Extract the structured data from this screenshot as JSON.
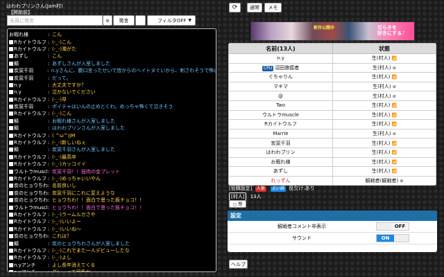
{
  "room": {
    "title": "はわわプリンさん(Jam村)",
    "phase": "【開始前】"
  },
  "composer": {
    "placeholder": "全員に発言",
    "say_label": "発言",
    "menu_icon": "≡",
    "color_icon": "■",
    "filter_label": "フィルタOFF",
    "filter_caret": "▼"
  },
  "log": [
    {
      "speaker": "お暇れ様",
      "checkbox": false,
      "text": "こん",
      "color": "#ffd54a"
    },
    {
      "speaker": "Rカイトウルフ",
      "checkbox": true,
      "text": "(-_-)こん",
      "color": "#ffd54a"
    },
    {
      "speaker": "Rカイトウルフ",
      "checkbox": true,
      "text": "(-_-)濁がた",
      "color": "#ffd54a"
    },
    {
      "speaker": "あずし",
      "checkbox": true,
      "text": "こん",
      "color": "#ffd54a"
    },
    {
      "speaker": "鯖",
      "checkbox": true,
      "text": "あずしさんが入室しました",
      "color": "#6fc6ff"
    },
    {
      "speaker": "炭窯千羽",
      "checkbox": true,
      "text": "n.yさんに、腹口言ったせいで皆からのヘイトヌぐいから、刺されそうで怖い",
      "color": "#6fc6ff"
    },
    {
      "speaker": "炭窯千羽",
      "checkbox": true,
      "text": "だって。",
      "color": "#6fc6ff"
    },
    {
      "speaker": "n.y",
      "checkbox": true,
      "text": "大丈夫ですか？",
      "color": "#ffd54a"
    },
    {
      "speaker": "n.y",
      "checkbox": true,
      "text": "泣かないでください",
      "color": "#ffd54a"
    },
    {
      "speaker": "Rカイトウルフ",
      "checkbox": true,
      "text": "(-_-)早",
      "color": "#ffd54a"
    },
    {
      "speaker": "炭窯千羽",
      "checkbox": true,
      "text": "ポイテャはいんの止めとくわ。めっちゃ怖くて泣きそう",
      "color": "#6fc6ff"
    },
    {
      "speaker": "Rカイトウルフ",
      "checkbox": true,
      "text": "(-_-)こん",
      "color": "#ffd54a"
    },
    {
      "speaker": "鯖",
      "checkbox": true,
      "text": "お暇れ様さんが入室しました",
      "color": "#6fc6ff"
    },
    {
      "speaker": "鯖",
      "checkbox": true,
      "text": "はわわプリンさんが入室しました",
      "color": "#6fc6ff"
    },
    {
      "speaker": "Rカイトウルフ",
      "checkbox": true,
      "text": "( ^ω^)JM",
      "color": "#ffd54a"
    },
    {
      "speaker": "Rカイトウルフ",
      "checkbox": true,
      "text": "(-_-)新しいねぇ",
      "color": "#ffd54a"
    },
    {
      "speaker": "鯖",
      "checkbox": true,
      "text": "炭窯千羽さんが入室しました",
      "color": "#6fc6ff"
    },
    {
      "speaker": "Rカイトウルフ",
      "checkbox": true,
      "text": "(-_-)最高卒",
      "color": "#ffd54a"
    },
    {
      "speaker": "Rカイトウルフ",
      "checkbox": true,
      "text": "(-_-)カッコイイ",
      "color": "#ffd54a"
    },
    {
      "speaker": "ウルトラmuscle",
      "checkbox": true,
      "text": "炭窯千羽！！鼓肉の金プレット",
      "color": "#ff6ad5"
    },
    {
      "speaker": "Rカイトウルフ",
      "checkbox": true,
      "text": "(-_-)めっちゃいいやん",
      "color": "#ffd54a"
    },
    {
      "speaker": "炭のヒョウちわ",
      "checkbox": true,
      "text": "名前良いし",
      "color": "#ffd54a"
    },
    {
      "speaker": "炭のヒョウちわ",
      "checkbox": true,
      "text": "炭窯千羽にこれに変えような",
      "color": "#ffd54a"
    },
    {
      "speaker": "炭のヒョウちわ",
      "checkbox": true,
      "text": "ヒョウちわ！！面白で思った板チョコ！！",
      "color": "#ffd54a"
    },
    {
      "speaker": "ウルトラmuscle",
      "checkbox": true,
      "text": "ヒョウちわ！！面白で思った板チョコ！！",
      "color": "#ff6ad5"
    },
    {
      "speaker": "Rカイトウルフ",
      "checkbox": true,
      "text": "(-_-)ラームルガさや",
      "color": "#ffd54a"
    },
    {
      "speaker": "Rカイトウルフ",
      "checkbox": true,
      "text": "(-_-)いいよー",
      "color": "#ffd54a"
    },
    {
      "speaker": "Rカイトウルフ",
      "checkbox": true,
      "text": "(-_-)いいね〜",
      "color": "#ffd54a"
    },
    {
      "speaker": "炭のヒョウちわ",
      "checkbox": true,
      "text": "これは？",
      "color": "#ffd54a"
    },
    {
      "speaker": "鯖",
      "checkbox": true,
      "text": "炭のヒョウちわさんが入室しました",
      "color": "#6fc6ff"
    },
    {
      "speaker": "Rカイトウルフ",
      "checkbox": true,
      "text": "(-_-)これでまた一人デビューしたな",
      "color": "#ffd54a"
    },
    {
      "speaker": "Rカイトウルフ",
      "checkbox": true,
      "text": "(-_-)よし",
      "color": "#ffd54a"
    },
    {
      "speaker": "n.yアンチ",
      "checkbox": true,
      "text": "よし長年消えてくる",
      "color": "#ffd54a"
    },
    {
      "speaker": "n.yアンチ",
      "checkbox": true,
      "text": "グレーって居色か",
      "color": "#ffd54a"
    }
  ],
  "top_buttons": {
    "refresh_icon": "⟳",
    "normal_label": "通常",
    "memo_label": "メモ"
  },
  "banner": {
    "left_text": "新作公開中",
    "right_text": "ぢらきを\n好きにする♪"
  },
  "players_table": {
    "header_name": "名前(13人)",
    "header_status": "状態",
    "rows": [
      {
        "name": "n.y",
        "status": "生(村人)",
        "signal": "📶",
        "badge": "",
        "name_color": "#111"
      },
      {
        "name": "沼田狼狐者",
        "status": "生(村人)",
        "signal": "⊘",
        "badge": "CPU",
        "name_color": "#111"
      },
      {
        "name": "ぐちゃりん",
        "status": "生(村人)",
        "signal": "📶",
        "badge": "",
        "name_color": "#111"
      },
      {
        "name": "マキマ",
        "status": "生(村人)",
        "signal": "⊘",
        "badge": "",
        "name_color": "#111"
      },
      {
        "name": "@",
        "status": "生(村人)",
        "signal": "⊘",
        "badge": "",
        "name_color": "#111"
      },
      {
        "name": "Two",
        "status": "生(村人)",
        "signal": "📶",
        "badge": "",
        "name_color": "#111"
      },
      {
        "name": "ウルトラmuscle",
        "status": "生(村人)",
        "signal": "📶",
        "badge": "",
        "name_color": "#111"
      },
      {
        "name": "Rカイトウルフ",
        "status": "生(村人)",
        "signal": "📶",
        "badge": "",
        "name_color": "#111"
      },
      {
        "name": "Marrie",
        "status": "生(村人)",
        "signal": "⊘",
        "badge": "",
        "name_color": "#111"
      },
      {
        "name": "炭窯千羽",
        "status": "生(村人)",
        "signal": "📶",
        "badge": "",
        "name_color": "#111"
      },
      {
        "name": "はわわプリン",
        "status": "生(村人)",
        "signal": "📶",
        "badge": "",
        "name_color": "#111"
      },
      {
        "name": "お暇れ様",
        "status": "生(村人)",
        "signal": "📶",
        "badge": "",
        "name_color": "#111"
      },
      {
        "name": "あずし",
        "status": "生(村人)",
        "signal": "📶",
        "badge": "",
        "name_color": "#111"
      },
      {
        "name": "れっずん",
        "status": "観戦者(観戦者)",
        "signal": "⊘",
        "badge": "",
        "name_color": "#d32f2f"
      }
    ]
  },
  "rules": {
    "label": "[役職設定]",
    "badge_1": "人狼",
    "badge_1_color": "#d32f2f",
    "badge_2": "占い師",
    "badge_2_color": "#1e88e5",
    "rest": "役欠け:あり"
  },
  "villagers": {
    "label": "[村人]",
    "count": "13人"
  },
  "shutter": {
    "label": "▢ 閉"
  },
  "settings": {
    "title": "設定",
    "rows": [
      {
        "label": "観戦者コメント非表示",
        "state": "OFF"
      },
      {
        "label": "サウンド",
        "state": "ON"
      }
    ]
  },
  "help": {
    "label": "ヘルプ"
  }
}
